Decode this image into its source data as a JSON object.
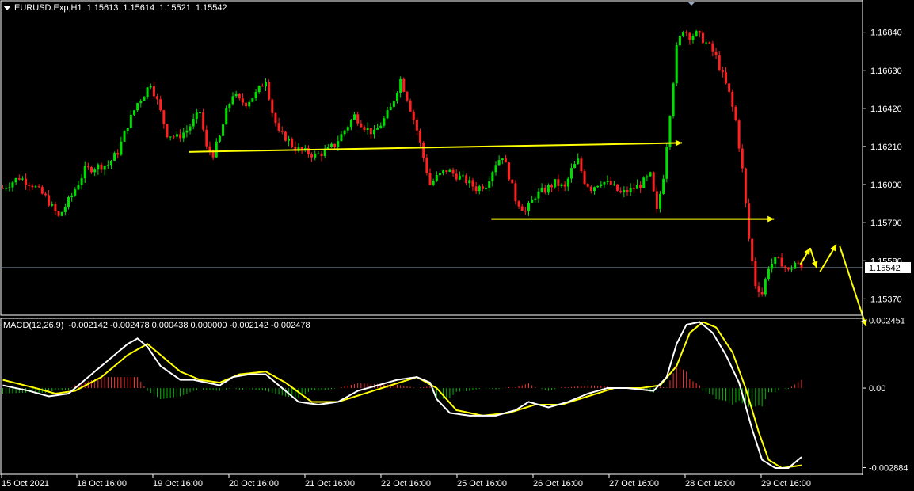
{
  "header": {
    "symbol": "EURUSD.Exp,H1",
    "open": "1.15613",
    "high": "1.15614",
    "low": "1.15521",
    "close": "1.15542"
  },
  "macd_header": {
    "label": "MACD(12,26,9)",
    "values": "-0.002142 -0.002478 0.000438 0.000000 -0.002142 -0.002478"
  },
  "colors": {
    "background": "#000000",
    "bull_candle": "#00e000",
    "bear_candle": "#ff2020",
    "annotation": "#ffff00",
    "macd_main": "#ffffff",
    "macd_signal": "#ffff00",
    "hist_positive": "#ff3030",
    "hist_negative": "#00c000",
    "grid_border": "#ffffff"
  },
  "chart_data": [
    {
      "type": "candlestick",
      "title": "EURUSD.Exp,H1",
      "y_ticks": [
        "1.16840",
        "1.16630",
        "1.16420",
        "1.16210",
        "1.16000",
        "1.15790",
        "1.15580",
        "1.15370"
      ],
      "ylim": [
        1.1528,
        1.17
      ],
      "current_price": "1.15542",
      "x_ticks": [
        "15 Oct 2021",
        "18 Oct 16:00",
        "19 Oct 16:00",
        "20 Oct 16:00",
        "21 Oct 16:00",
        "22 Oct 16:00",
        "25 Oct 16:00",
        "26 Oct 16:00",
        "27 Oct 16:00",
        "28 Oct 16:00",
        "29 Oct 16:00"
      ],
      "close_path": [
        [
          0,
          1.1598
        ],
        [
          5,
          1.1604
        ],
        [
          9,
          1.16
        ],
        [
          13,
          1.1593
        ],
        [
          17,
          1.1582
        ],
        [
          21,
          1.1594
        ],
        [
          25,
          1.1608
        ],
        [
          29,
          1.161
        ],
        [
          32,
          1.1611
        ],
        [
          35,
          1.1618
        ],
        [
          38,
          1.1633
        ],
        [
          41,
          1.1645
        ],
        [
          43,
          1.165
        ],
        [
          45,
          1.1656
        ],
        [
          47,
          1.1646
        ],
        [
          50,
          1.1628
        ],
        [
          53,
          1.1626
        ],
        [
          56,
          1.163
        ],
        [
          58,
          1.1635
        ],
        [
          60,
          1.164
        ],
        [
          62,
          1.162
        ],
        [
          64,
          1.1617
        ],
        [
          66,
          1.1626
        ],
        [
          68,
          1.164
        ],
        [
          70,
          1.165
        ],
        [
          72,
          1.1646
        ],
        [
          74,
          1.1645
        ],
        [
          77,
          1.165
        ],
        [
          80,
          1.1658
        ],
        [
          82,
          1.164
        ],
        [
          84,
          1.1628
        ],
        [
          86,
          1.1626
        ],
        [
          89,
          1.162
        ],
        [
          92,
          1.1618
        ],
        [
          95,
          1.1616
        ],
        [
          98,
          1.1618
        ],
        [
          101,
          1.1622
        ],
        [
          104,
          1.163
        ],
        [
          107,
          1.1638
        ],
        [
          110,
          1.1632
        ],
        [
          113,
          1.1628
        ],
        [
          116,
          1.1636
        ],
        [
          118,
          1.1642
        ],
        [
          121,
          1.1658
        ],
        [
          123,
          1.1648
        ],
        [
          126,
          1.163
        ],
        [
          128,
          1.1615
        ],
        [
          130,
          1.16
        ],
        [
          132,
          1.1604
        ],
        [
          135,
          1.1608
        ],
        [
          138,
          1.1605
        ],
        [
          141,
          1.1602
        ],
        [
          144,
          1.1598
        ],
        [
          147,
          1.16
        ],
        [
          150,
          1.1612
        ],
        [
          152,
          1.1616
        ],
        [
          154,
          1.1605
        ],
        [
          156,
          1.1592
        ],
        [
          159,
          1.1585
        ],
        [
          162,
          1.1594
        ],
        [
          165,
          1.1597
        ],
        [
          168,
          1.1601
        ],
        [
          171,
          1.1598
        ],
        [
          173,
          1.1608
        ],
        [
          175,
          1.1613
        ],
        [
          177,
          1.1602
        ],
        [
          179,
          1.1598
        ],
        [
          182,
          1.1602
        ],
        [
          185,
          1.16
        ],
        [
          188,
          1.1595
        ],
        [
          191,
          1.1597
        ],
        [
          194,
          1.16
        ],
        [
          197,
          1.1605
        ],
        [
          199,
          1.1585
        ],
        [
          201,
          1.1605
        ],
        [
          203,
          1.164
        ],
        [
          205,
          1.1675
        ],
        [
          207,
          1.1686
        ],
        [
          209,
          1.1682
        ],
        [
          211,
          1.1683
        ],
        [
          213,
          1.168
        ],
        [
          215,
          1.1676
        ],
        [
          217,
          1.167
        ],
        [
          219,
          1.166
        ],
        [
          221,
          1.165
        ],
        [
          223,
          1.1635
        ],
        [
          225,
          1.1608
        ],
        [
          227,
          1.157
        ],
        [
          229,
          1.1545
        ],
        [
          231,
          1.154
        ],
        [
          233,
          1.1555
        ],
        [
          235,
          1.1558
        ],
        [
          237,
          1.1557
        ],
        [
          239,
          1.1552
        ],
        [
          241,
          1.1557
        ],
        [
          243,
          1.1554
        ]
      ],
      "annotations": [
        {
          "from": [
            57,
            1.1618
          ],
          "to": [
            207,
            1.1623
          ],
          "style": "arrow"
        },
        {
          "from": [
            149,
            1.1581
          ],
          "to": [
            235,
            1.1581
          ],
          "style": "arrow"
        },
        {
          "from": [
            243,
            1.1556
          ],
          "to": [
            246,
            1.1565
          ],
          "style": "arrow"
        },
        {
          "from": [
            246,
            1.1565
          ],
          "to": [
            248,
            1.1554
          ],
          "style": "arrow"
        },
        {
          "from": [
            249,
            1.1552
          ],
          "to": [
            254,
            1.1567
          ],
          "style": "arrow"
        },
        {
          "from": [
            255,
            1.1566
          ],
          "to": [
            263,
            1.1522
          ],
          "style": "arrow"
        }
      ]
    },
    {
      "type": "macd",
      "title": "MACD(12,26,9)",
      "y_ticks": [
        "0.002451",
        "0.00",
        "-0.002884"
      ],
      "ylim": [
        -0.0031,
        0.0025
      ],
      "main_path": [
        [
          0,
          0.0001
        ],
        [
          8,
          -0.0001
        ],
        [
          14,
          -0.0003
        ],
        [
          20,
          -0.0002
        ],
        [
          26,
          0.0004
        ],
        [
          32,
          0.001
        ],
        [
          38,
          0.0016
        ],
        [
          41,
          0.0018
        ],
        [
          44,
          0.0015
        ],
        [
          48,
          0.0008
        ],
        [
          54,
          0.0003
        ],
        [
          58,
          0.0003
        ],
        [
          62,
          0.0002
        ],
        [
          66,
          0.0001
        ],
        [
          70,
          0.0004
        ],
        [
          75,
          0.0005
        ],
        [
          80,
          0.0005
        ],
        [
          84,
          0.0001
        ],
        [
          90,
          -0.0005
        ],
        [
          96,
          -0.0006
        ],
        [
          102,
          -0.0005
        ],
        [
          108,
          -0.0001
        ],
        [
          114,
          0.0001
        ],
        [
          120,
          0.0003
        ],
        [
          126,
          0.0004
        ],
        [
          130,
          0.0002
        ],
        [
          132,
          -0.0004
        ],
        [
          136,
          -0.0009
        ],
        [
          142,
          -0.001
        ],
        [
          150,
          -0.001
        ],
        [
          156,
          -0.0008
        ],
        [
          160,
          -0.0005
        ],
        [
          166,
          -0.0007
        ],
        [
          172,
          -0.0005
        ],
        [
          178,
          -0.0002
        ],
        [
          184,
          0.0
        ],
        [
          190,
          0.0
        ],
        [
          198,
          -0.0001
        ],
        [
          202,
          0.0004
        ],
        [
          205,
          0.0016
        ],
        [
          208,
          0.0023
        ],
        [
          212,
          0.0024
        ],
        [
          216,
          0.002
        ],
        [
          220,
          0.0012
        ],
        [
          224,
          0.0002
        ],
        [
          228,
          -0.0015
        ],
        [
          231,
          -0.0026
        ],
        [
          235,
          -0.0029
        ],
        [
          239,
          -0.0029
        ],
        [
          243,
          -0.0025
        ]
      ],
      "signal_path": [
        [
          0,
          0.0003
        ],
        [
          10,
          0.0
        ],
        [
          16,
          -0.0002
        ],
        [
          22,
          -0.0001
        ],
        [
          30,
          0.0004
        ],
        [
          38,
          0.0012
        ],
        [
          44,
          0.0016
        ],
        [
          48,
          0.0012
        ],
        [
          54,
          0.0006
        ],
        [
          60,
          0.0003
        ],
        [
          66,
          0.0002
        ],
        [
          72,
          0.0005
        ],
        [
          80,
          0.0006
        ],
        [
          86,
          0.0002
        ],
        [
          94,
          -0.0005
        ],
        [
          102,
          -0.0005
        ],
        [
          110,
          -0.0002
        ],
        [
          118,
          0.0001
        ],
        [
          126,
          0.0004
        ],
        [
          132,
          0.0
        ],
        [
          138,
          -0.0008
        ],
        [
          146,
          -0.001
        ],
        [
          154,
          -0.0009
        ],
        [
          162,
          -0.0006
        ],
        [
          170,
          -0.0006
        ],
        [
          178,
          -0.0003
        ],
        [
          186,
          0.0
        ],
        [
          194,
          0.0
        ],
        [
          200,
          0.0001
        ],
        [
          205,
          0.0008
        ],
        [
          209,
          0.002
        ],
        [
          213,
          0.0024
        ],
        [
          217,
          0.0022
        ],
        [
          222,
          0.0013
        ],
        [
          226,
          0.0
        ],
        [
          230,
          -0.0016
        ],
        [
          233,
          -0.0026
        ],
        [
          237,
          -0.0029
        ],
        [
          243,
          -0.0028
        ]
      ]
    }
  ]
}
